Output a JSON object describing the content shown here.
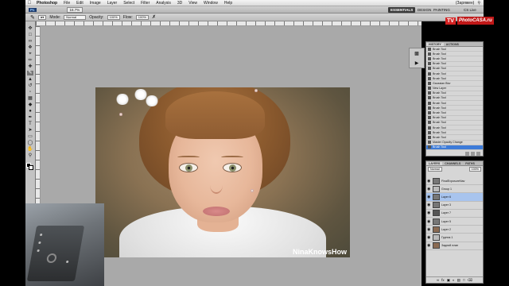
{
  "menubar": {
    "items": [
      "Photoshop",
      "File",
      "Edit",
      "Image",
      "Layer",
      "Select",
      "Filter",
      "Analysis",
      "3D",
      "View",
      "Window",
      "Help"
    ],
    "right_text": "(Заряжен)"
  },
  "appbar": {
    "zoom": "16.7%",
    "workspaces": [
      "ESSENTIALS",
      "DESIGN",
      "PAINTING"
    ],
    "cs_live": "CS Live"
  },
  "options": {
    "mode_label": "Mode:",
    "mode_value": "Normal",
    "opacity_label": "Opacity:",
    "opacity_value": "100%",
    "flow_label": "Flow:",
    "flow_value": "100%"
  },
  "logo": {
    "tv": "TV",
    "brand": "PhotoCASA.ru"
  },
  "watermark": "NinaKnowsHow",
  "history": {
    "tabs": [
      "HISTORY",
      "ACTIONS"
    ],
    "rows": [
      "Brush Tool",
      "Brush Tool",
      "Brush Tool",
      "Brush Tool",
      "Brush Tool",
      "Brush Tool",
      "Brush Tool",
      "Gaussian Blur",
      "New Layer",
      "Brush Tool",
      "Brush Tool",
      "Brush Tool",
      "Brush Tool",
      "Brush Tool",
      "Brush Tool",
      "Brush Tool",
      "Brush Tool",
      "Brush Tool",
      "Brush Tool",
      "Master Opacity Change",
      "Brush Tool"
    ]
  },
  "layers": {
    "tabs": [
      "LAYERS",
      "CHANNELS",
      "PATHS"
    ],
    "blend": "Normal",
    "opacity": "100%",
    "rows": [
      "FinalExposureNav",
      "Group 1",
      "Layer 6",
      "Layer 3",
      "Layer 7",
      "Layer 5",
      "Layer 2",
      "Группа 1",
      "Задний план"
    ]
  },
  "colors": {
    "accent_blue": "#3d7bd8",
    "panel_bg": "#d6d6d6",
    "workspace_bg": "#a9a9a9"
  }
}
